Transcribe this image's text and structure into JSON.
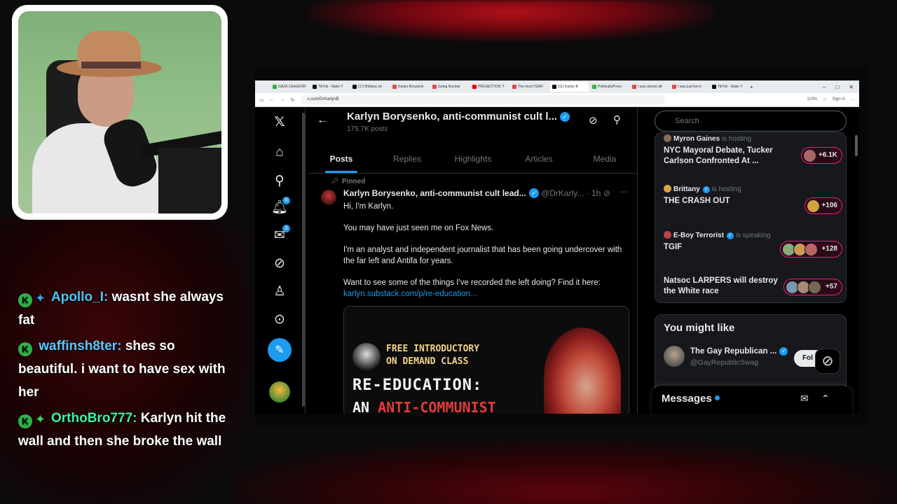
{
  "webcam": {
    "label": "streamer webcam"
  },
  "chat": [
    {
      "username": "Apollo_I",
      "sep": ":",
      "message": "wasnt she always fat"
    },
    {
      "username": "waffinsh8ter",
      "sep": ":",
      "message": "shes so beautiful. i want to have sex with her"
    },
    {
      "username": "OrthoBro777",
      "sep": ":",
      "message": "Karlyn hit the wall and then she broke the wall"
    }
  ],
  "browser": {
    "tabs": [
      "GAZA CEASEFIR",
      "TikTok - Make Y",
      "(17) Brittany on",
      "Karlyn Borysenk",
      "Going Nuclear",
      "PROJECTION: T",
      "The most TERR",
      "(11) Karlyn B",
      "PoliticallyProvo",
      "I was almost att",
      "I was just live tr",
      "TikTok - Make Y"
    ],
    "url": "x.com/DrKarlynB",
    "zoom": "110%",
    "signin": "Sign in"
  },
  "nav": {
    "notifications_badge": "8",
    "messages_badge": "3"
  },
  "profile": {
    "name": "Karlyn Borysenko, anti-communist cult l...",
    "posts_count": "175.7K posts",
    "tabs": [
      "Posts",
      "Replies",
      "Highlights",
      "Articles",
      "Media"
    ]
  },
  "tweet": {
    "pinned_label": "Pinned",
    "author": "Karlyn Borysenko, anti-communist cult lead...",
    "handle": "@DrKarly...",
    "time": "· 1h",
    "paragraphs": [
      "Hi, I'm Karlyn.",
      "You may have just seen me on Fox News.",
      "I'm an analyst and independent journalist that has been going undercover with the far left and Antifa for years.",
      "Want to see some of the things I've recorded the left doing? Find it here:"
    ],
    "link": "karlyn.substack.com/p/re-education...",
    "media": {
      "line1": "FREE INTRODUCTORY",
      "line2": "ON DEMAND CLASS",
      "title": "RE-EDUCATION:",
      "sub_prefix": "AN",
      "sub_red": "ANTI-COMMUNIST"
    }
  },
  "right": {
    "search_placeholder": "Search",
    "spaces": [
      {
        "host": "Myron Gaines",
        "host_suffix": "is hosting",
        "title": "NYC Mayoral Debate,  Tucker Carlson Confronted At ...",
        "count": "+6.1K"
      },
      {
        "host": "Brittany",
        "host_suffix": "is hosting",
        "title": "THE CRASH OUT",
        "count": "+106"
      },
      {
        "host": "E-Boy Terrorist",
        "host_suffix": "is speaking",
        "title": "TGIF",
        "count": "+128"
      },
      {
        "host": "",
        "host_suffix": "",
        "title": "Natsoc LARPERS will destroy the White race",
        "count": "+57"
      }
    ],
    "you_might_like": "You might like",
    "suggestion": {
      "name": "The Gay Republican ...",
      "handle": "@GayRepublicSwag",
      "button": "Fol"
    },
    "messages": "Messages"
  },
  "colors": {
    "accent": "#1d9bf0",
    "live_pink": "#f91880",
    "background": "#000000"
  }
}
